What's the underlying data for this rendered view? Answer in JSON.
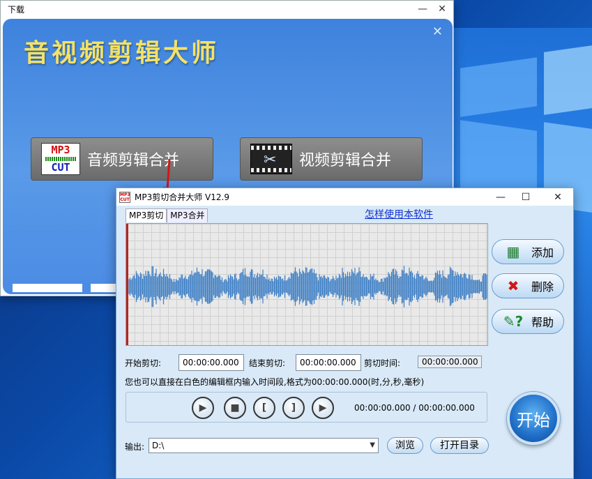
{
  "back_window": {
    "title": "下载",
    "app_title": "音视频剪辑大师",
    "audio_button_label": "音频剪辑合并",
    "video_button_label": "视频剪辑合并",
    "audio_icon_top": "MP3",
    "audio_icon_bottom": "CUT"
  },
  "main_window": {
    "title": "MP3剪切合并大师 V12.9",
    "icon_text": "MP3 CUT",
    "tabs": [
      {
        "label": "MP3剪切",
        "active": true
      },
      {
        "label": "MP3合并",
        "active": false
      }
    ],
    "help_link": "怎样使用本软件",
    "side_buttons": {
      "add": "添加",
      "delete": "删除",
      "help": "帮助"
    },
    "cut": {
      "start_label": "开始剪切:",
      "start_value": "00:00:00.000",
      "end_label": "结束剪切:",
      "end_value": "00:00:00.000",
      "duration_label": "剪切时间:",
      "duration_value": "00:00:00.000"
    },
    "hint": "您也可以直接在白色的编辑框内输入时间段,格式为00:00:00.000(时,分,秒,毫秒)",
    "player": {
      "time_display": "00:00:00.000 / 00:00:00.000"
    },
    "start_button": "开始",
    "output": {
      "label": "输出:",
      "value": "D:\\",
      "browse": "浏览",
      "open_dir": "打开目录"
    }
  },
  "colors": {
    "accent": "#1f6ec8",
    "waveform": "#3d7fc6",
    "app_title_color": "#f4e266"
  }
}
